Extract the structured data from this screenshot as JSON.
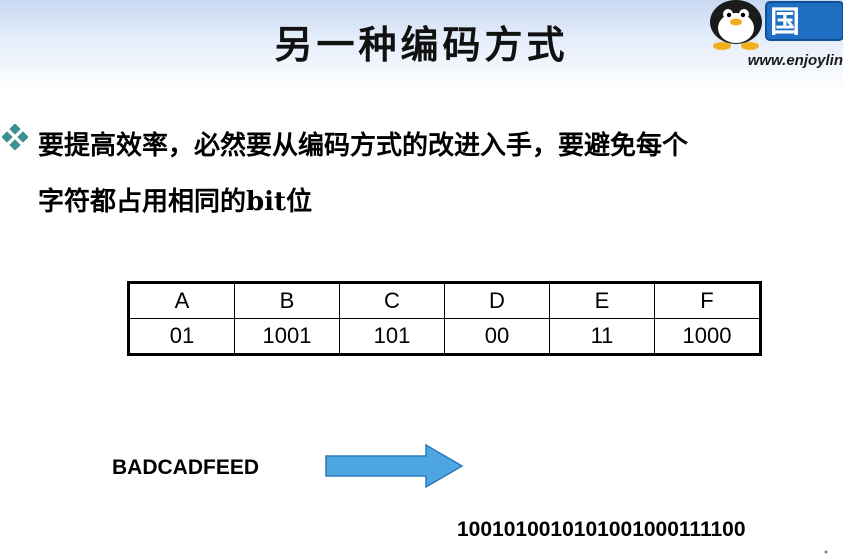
{
  "slide": {
    "title": "另一种编码方式",
    "logo_text": "www.enjoylin",
    "logo_sign_text": "国"
  },
  "bullet": {
    "icon": "diamond-bullet-icon",
    "line1": "要提高效率，必然要从编码方式的改进入手，要避免每个",
    "line2": "字符都占用相同的bit位"
  },
  "table": {
    "letters": [
      "A",
      "B",
      "C",
      "D",
      "E",
      "F"
    ],
    "codes": [
      "01",
      "1001",
      "101",
      "00",
      "11",
      "1000"
    ]
  },
  "example": {
    "input": "BADCADFEED",
    "output": "1001010010101001000111100"
  },
  "colors": {
    "arrow_fill": "#4da6e0",
    "arrow_stroke": "#2a78b8",
    "bullet_color": "#3a8f8f",
    "header_gradient_top": "#c9d9f2"
  }
}
